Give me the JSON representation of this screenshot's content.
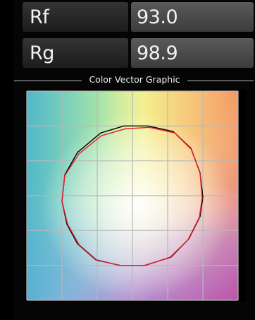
{
  "metrics": {
    "rf": {
      "label": "Rf",
      "value": "93.0"
    },
    "rg": {
      "label": "Rg",
      "value": "98.9"
    }
  },
  "section": {
    "title": "Color Vector Graphic"
  },
  "chart_data": {
    "type": "line",
    "title": "",
    "grid": true,
    "legend": "none",
    "xlim": [
      -1.5,
      1.5
    ],
    "ylim": [
      -1.5,
      1.5
    ],
    "series": [
      {
        "color": "#000000",
        "x": [
          1.0,
          0.96,
          0.83,
          0.58,
          0.22,
          -0.12,
          -0.45,
          -0.78,
          -0.96,
          -1.0,
          -0.93,
          -0.78,
          -0.52,
          -0.18,
          0.18,
          0.55,
          0.8,
          0.96
        ],
        "y": [
          -0.02,
          0.33,
          0.68,
          0.92,
          1.0,
          1.0,
          0.9,
          0.62,
          0.3,
          -0.08,
          -0.41,
          -0.69,
          -0.92,
          -1.0,
          -1.0,
          -0.88,
          -0.62,
          -0.3
        ]
      },
      {
        "color": "#e0202a",
        "x": [
          0.99,
          0.96,
          0.84,
          0.6,
          0.24,
          -0.1,
          -0.44,
          -0.76,
          -0.96,
          -1.0,
          -0.92,
          -0.76,
          -0.5,
          -0.17,
          0.17,
          0.53,
          0.79,
          0.95
        ],
        "y": [
          -0.03,
          0.32,
          0.66,
          0.9,
          0.98,
          0.96,
          0.86,
          0.6,
          0.29,
          -0.08,
          -0.41,
          -0.7,
          -0.93,
          -1.0,
          -1.0,
          -0.89,
          -0.63,
          -0.31
        ]
      }
    ]
  }
}
